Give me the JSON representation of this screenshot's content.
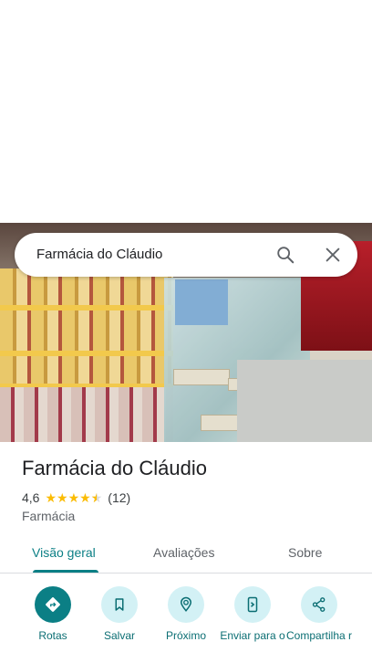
{
  "search": {
    "query": "Farmácia do Cláudio"
  },
  "place": {
    "name": "Farmácia do Cláudio",
    "rating": "4,6",
    "stars": 4.5,
    "review_count": "(12)",
    "category": "Farmácia"
  },
  "tabs": [
    {
      "label": "Visão geral",
      "active": true
    },
    {
      "label": "Avaliações",
      "active": false
    },
    {
      "label": "Sobre",
      "active": false
    }
  ],
  "actions": [
    {
      "label": "Rotas",
      "icon": "directions-icon"
    },
    {
      "label": "Salvar",
      "icon": "bookmark-icon"
    },
    {
      "label": "Próximo",
      "icon": "nearby-icon"
    },
    {
      "label": "Enviar para o",
      "icon": "send-to-phone-icon"
    },
    {
      "label": "Compartilha r",
      "icon": "share-icon"
    }
  ],
  "colors": {
    "accent": "#0b7f85",
    "chip": "#d3f1f5",
    "star": "#fbbc04"
  }
}
